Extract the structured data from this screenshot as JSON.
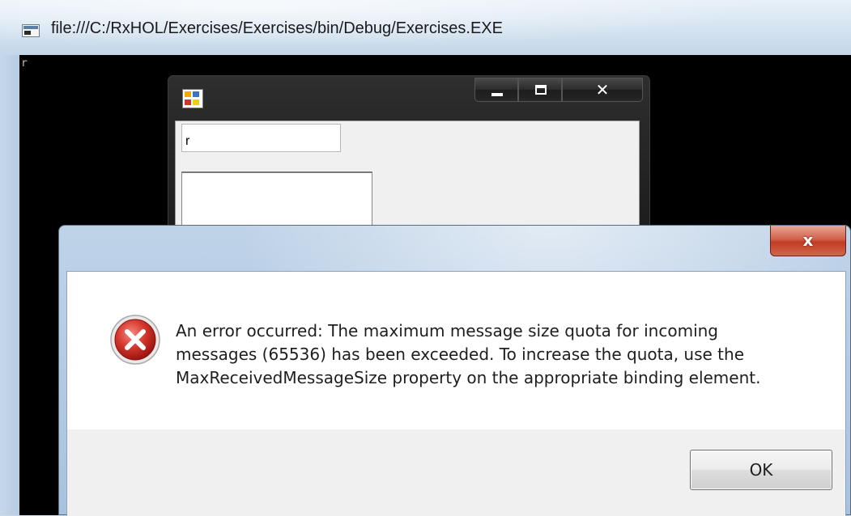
{
  "console": {
    "title": "file:///C:/RxHOL/Exercises/Exercises/bin/Debug/Exercises.EXE",
    "output_text": "r"
  },
  "form_window": {
    "text_input_value": "r"
  },
  "error_dialog": {
    "close_label": "x",
    "message": "An error occurred: The maximum message size quota for incoming\nmessages (65536) has been exceeded. To increase the quota, use the\nMaxReceivedMessageSize property on the appropriate binding element.",
    "ok_label": "OK"
  },
  "icons": {
    "console": "console-app-icon",
    "form": "winforms-app-icon",
    "error": "error-x-icon"
  },
  "colors": {
    "console_background": "#000000",
    "error_icon_red": "#c8241c",
    "dialog_close_red": "#c13c22"
  }
}
